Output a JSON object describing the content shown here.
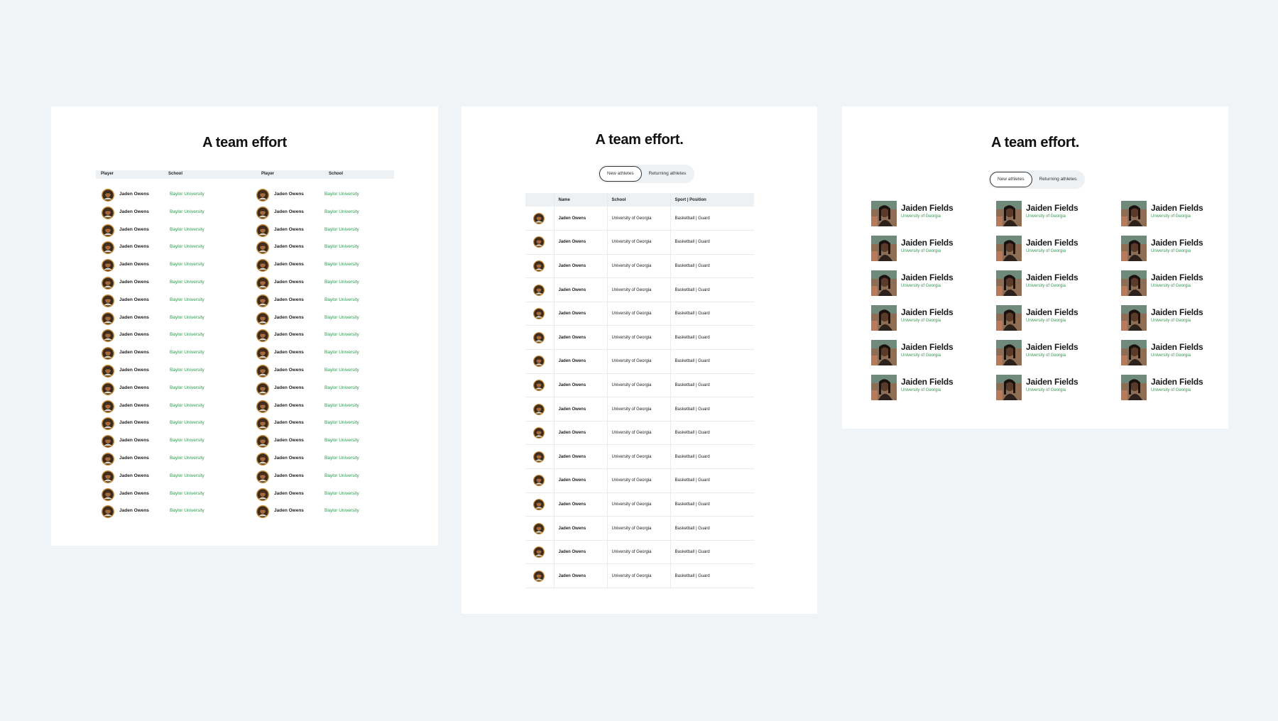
{
  "colors": {
    "background": "#f0f4f7",
    "card": "#ffffff",
    "accent_green": "#2e9a4f",
    "header_bg": "#eef1f4"
  },
  "card1": {
    "title": "A team effort",
    "headers": {
      "player": "Player",
      "school": "School"
    },
    "player_name": "Jaden Owens",
    "school_name": "Baylor University",
    "rows_per_column": 19,
    "columns": 2,
    "avatar_icon": "player-avatar-icon"
  },
  "card2": {
    "title": "A team effort.",
    "tabs": {
      "new": "New athletes",
      "returning": "Returning athletes",
      "selected": "New athletes"
    },
    "headers": {
      "name": "Name",
      "school": "School",
      "sport": "Sport | Position"
    },
    "player_name": "Jaden Owens",
    "school_name": "University of Georgia",
    "sport_position": "Basketball | Guard",
    "row_count": 16,
    "avatar_icon": "player-avatar-icon"
  },
  "card3": {
    "title": "A team effort.",
    "tabs": {
      "new": "New athletes",
      "returning": "Returning athletes",
      "selected": "New athletes"
    },
    "player_name": "Jaiden Fields",
    "school_name": "University of Georgia",
    "rows": 6,
    "columns": 3,
    "photo_icon": "player-photo-icon"
  }
}
